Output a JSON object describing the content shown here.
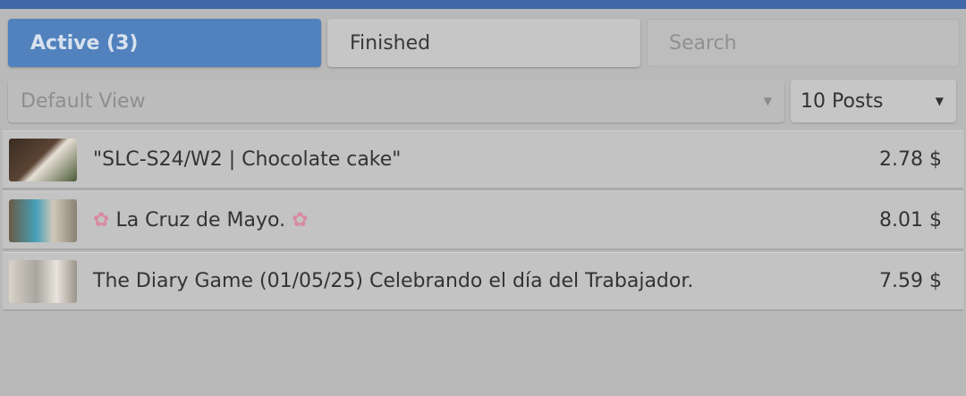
{
  "tabs": {
    "active_label": "Active (3)",
    "finished_label": "Finished",
    "search_placeholder": "Search"
  },
  "filters": {
    "view_selected": "Default View",
    "posts_selected": "10 Posts"
  },
  "posts": [
    {
      "title": "\"SLC-S24/W2 | Chocolate cake\"",
      "price": "2.78 $"
    },
    {
      "title": "La Cruz de Mayo.",
      "price": "8.01 $"
    },
    {
      "title": "The Diary Game (01/05/25) Celebrando el día del Trabajador.",
      "price": "7.59 $"
    }
  ],
  "colors": {
    "header_bar": "#4068a8",
    "active_tab": "#5182bd",
    "overlay_background": "#b9b9b9"
  },
  "icons": {
    "dropdown": "caret-down-icon",
    "emoji": "cherry-blossom-icon"
  }
}
